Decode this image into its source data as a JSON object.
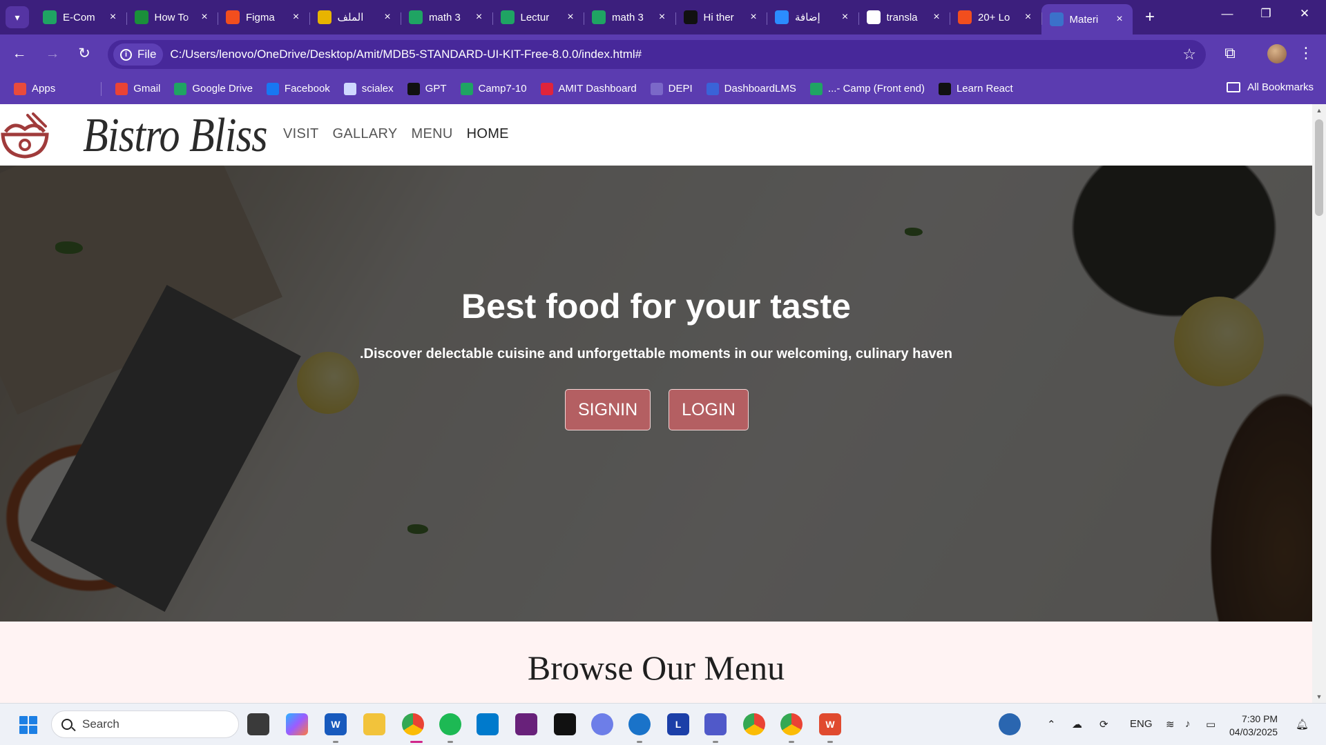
{
  "browser": {
    "tabs": [
      {
        "title": "E-Com",
        "favicon": "drive-icon",
        "color": "#1fa463"
      },
      {
        "title": "How To",
        "favicon": "w-icon",
        "color": "#1a8f3a"
      },
      {
        "title": "Figma",
        "favicon": "figma-icon",
        "color": "#f24e1e"
      },
      {
        "title": "الملف",
        "favicon": "five-icon",
        "color": "#e8b400"
      },
      {
        "title": "math 3",
        "favicon": "drive-icon",
        "color": "#1fa463"
      },
      {
        "title": "Lectur",
        "favicon": "drive-icon",
        "color": "#1fa463"
      },
      {
        "title": "math 3",
        "favicon": "drive-icon",
        "color": "#1fa463"
      },
      {
        "title": "Hi ther",
        "favicon": "openai-icon",
        "color": "#111111"
      },
      {
        "title": "إضافة",
        "favicon": "circle-icon",
        "color": "#2b8cff"
      },
      {
        "title": "transla",
        "favicon": "google-icon",
        "color": "#ffffff"
      },
      {
        "title": "20+ Lo",
        "favicon": "figma-icon",
        "color": "#f24e1e"
      },
      {
        "title": "Materi",
        "favicon": "mdb-icon",
        "color": "#3b71ca",
        "active": true
      }
    ],
    "new_tab_label": "+",
    "window_controls": {
      "minimize": "—",
      "restore": "❐",
      "close": "✕"
    },
    "address": {
      "chip_label": "File",
      "url": "C:/Users/lenovo/OneDrive/Desktop/Amit/MDB5-STANDARD-UI-KIT-Free-8.0.0/index.html#"
    },
    "bookmarks": [
      {
        "label": "Apps",
        "icon": "apps-icon",
        "color": "#e94b3c"
      },
      {
        "label": "",
        "icon": "grid-icon",
        "color": "#5b3cb0"
      },
      {
        "label": "Gmail",
        "icon": "gmail-icon",
        "color": "#ea4335"
      },
      {
        "label": "Google Drive",
        "icon": "drive-icon",
        "color": "#1fa463"
      },
      {
        "label": "Facebook",
        "icon": "facebook-icon",
        "color": "#1877f2"
      },
      {
        "label": "scialex",
        "icon": "doc-icon",
        "color": "#cfd8ff"
      },
      {
        "label": "GPT",
        "icon": "openai-icon",
        "color": "#111111"
      },
      {
        "label": "Camp7-10",
        "icon": "drive-icon",
        "color": "#1fa463"
      },
      {
        "label": "AMIT Dashboard",
        "icon": "amit-icon",
        "color": "#e0243b"
      },
      {
        "label": "DEPI",
        "icon": "depi-icon",
        "color": "#7b68c8"
      },
      {
        "label": "DashboardLMS",
        "icon": "lms-icon",
        "color": "#3a63d8"
      },
      {
        "label": "...- Camp (Front end)",
        "icon": "drive-icon",
        "color": "#1fa463"
      },
      {
        "label": "Learn React",
        "icon": "react-icon",
        "color": "#111111"
      }
    ],
    "all_bookmarks_label": "All Bookmarks"
  },
  "site": {
    "brand": "Bistro Bliss",
    "nav": [
      "VISIT",
      "GALLARY",
      "MENU",
      "HOME"
    ],
    "hero": {
      "title": "Best food for your taste",
      "subtitle": ".Discover delectable cuisine and unforgettable moments in our welcoming, culinary haven",
      "signin_label": "SIGNIN",
      "login_label": "LOGIN"
    },
    "menu_heading": "Browse Our Menu",
    "brand_color": "#b45f62"
  },
  "taskbar": {
    "search_placeholder": "Search",
    "tray": {
      "language": "ENG"
    },
    "clock": {
      "time": "7:30 PM",
      "date": "04/03/2025"
    }
  }
}
